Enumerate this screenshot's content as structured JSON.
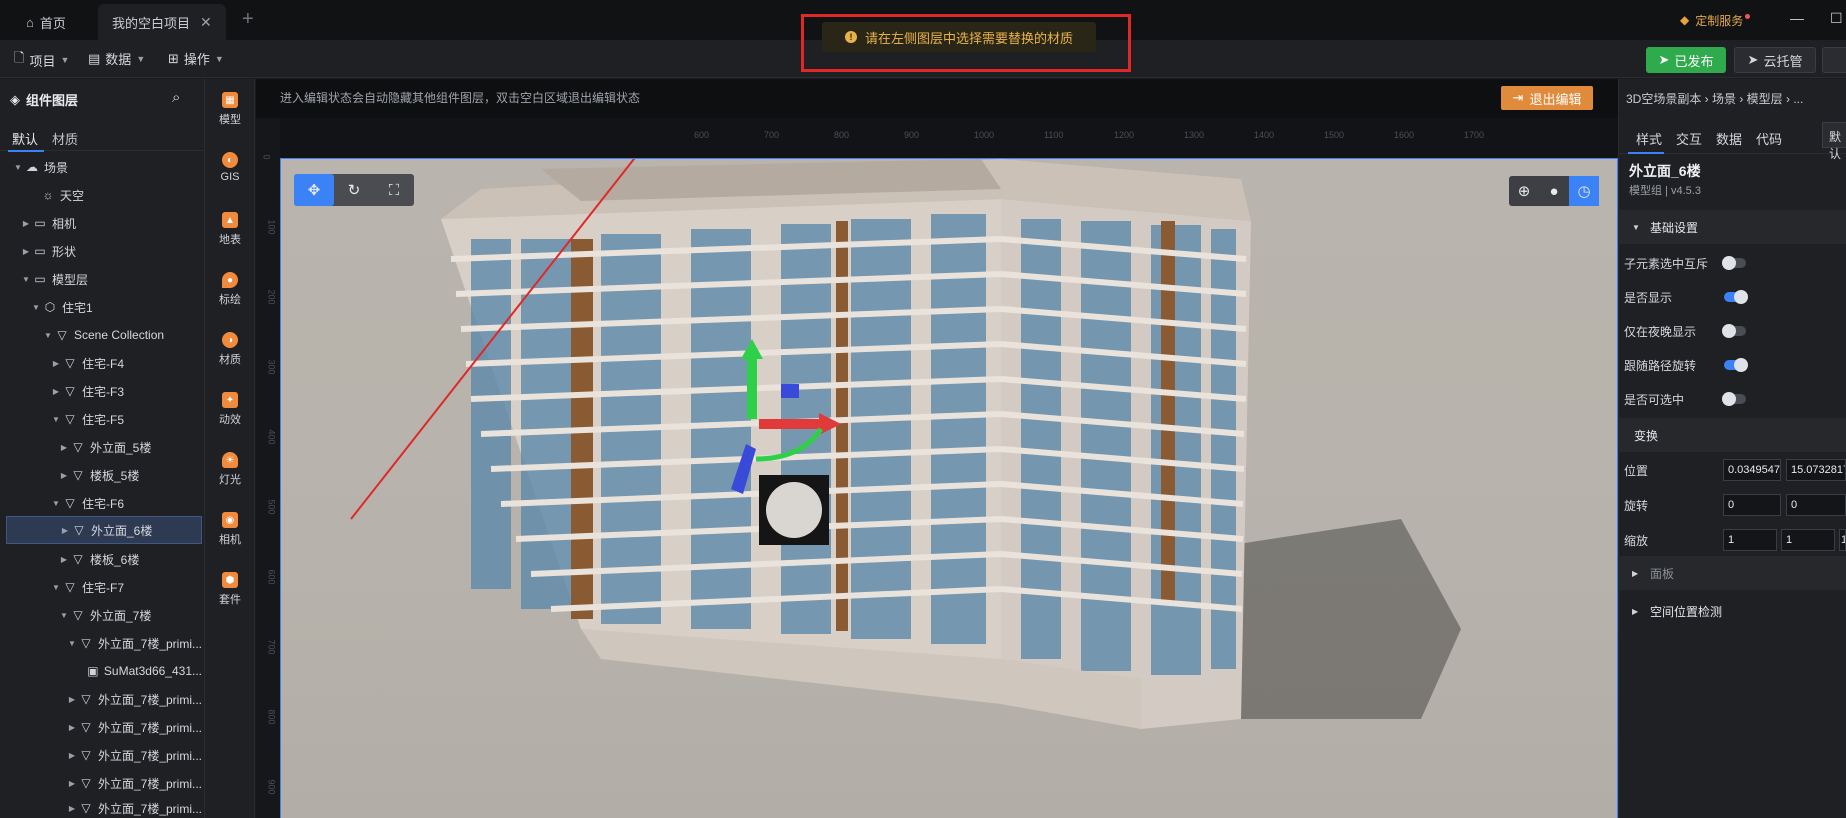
{
  "tabs": [
    {
      "label": "首页"
    },
    {
      "label": "我的空白项目"
    }
  ],
  "custom_service": "定制服务",
  "toolbar": {
    "project": "项目",
    "data": "数据",
    "operation": "操作",
    "publish": "已发布",
    "cloud": "云托管"
  },
  "toast": {
    "message": "请在左侧图层中选择需要替换的材质"
  },
  "left_panel": {
    "title": "组件图层",
    "tabs": [
      "默认",
      "材质"
    ],
    "tree": [
      {
        "label": "场景"
      },
      {
        "label": "天空"
      },
      {
        "label": "相机"
      },
      {
        "label": "形状"
      },
      {
        "label": "模型层"
      },
      {
        "label": "住宅1"
      },
      {
        "label": "Scene Collection"
      },
      {
        "label": "住宅-F4"
      },
      {
        "label": "住宅-F3"
      },
      {
        "label": "住宅-F5"
      },
      {
        "label": "外立面_5楼"
      },
      {
        "label": "楼板_5楼"
      },
      {
        "label": "住宅-F6"
      },
      {
        "label": "外立面_6楼"
      },
      {
        "label": "楼板_6楼"
      },
      {
        "label": "住宅-F7"
      },
      {
        "label": "外立面_7楼"
      },
      {
        "label": "外立面_7楼_primi..."
      },
      {
        "label": "SuMat3d66_431..."
      },
      {
        "label": "外立面_7楼_primi..."
      },
      {
        "label": "外立面_7楼_primi..."
      },
      {
        "label": "外立面_7楼_primi..."
      },
      {
        "label": "外立面_7楼_primi..."
      },
      {
        "label": "外立面_7楼_primi..."
      }
    ]
  },
  "icon_column": [
    "模型",
    "GIS",
    "地表",
    "标绘",
    "材质",
    "动效",
    "灯光",
    "相机",
    "套件"
  ],
  "viewport": {
    "hint": "进入编辑状态会自动隐藏其他组件图层，双击空白区域退出编辑状态",
    "exit_edit": "退出编辑",
    "ruler_h": [
      "600",
      "700",
      "800",
      "900",
      "1000",
      "1100",
      "1200",
      "1300",
      "1400",
      "1500",
      "1600",
      "1700"
    ],
    "ruler_v": [
      "0",
      "100",
      "200",
      "300",
      "400",
      "500",
      "600",
      "700",
      "800",
      "900"
    ]
  },
  "right_panel": {
    "breadcrumb": "3D空场景副本 › 场景 › 模型层 › ...",
    "tabs": [
      "样式",
      "交互",
      "数据",
      "代码"
    ],
    "default_btn": "默认",
    "object_name": "外立面_6楼",
    "object_sub": "模型组 | v4.5.3",
    "section_basic": "基础设置",
    "toggles": [
      {
        "label": "子元素选中互斥",
        "on": false
      },
      {
        "label": "是否显示",
        "on": true
      },
      {
        "label": "仅在夜晚显示",
        "on": false
      },
      {
        "label": "跟随路径旋转",
        "on": true
      },
      {
        "label": "是否可选中",
        "on": false
      }
    ],
    "section_transform": "变换",
    "position_label": "位置",
    "position": [
      "0.0349547",
      "15.0732817"
    ],
    "rotation_label": "旋转",
    "rotation": [
      "0",
      "0"
    ],
    "scale_label": "缩放",
    "scale": [
      "1",
      "1",
      "1"
    ],
    "section_panel": "面板",
    "section_space": "空间位置检测"
  },
  "colors": {
    "accent": "#3b82f6",
    "publish": "#2faa4c",
    "exit_edit": "#e08a3c",
    "toast_border": "#e02828"
  }
}
